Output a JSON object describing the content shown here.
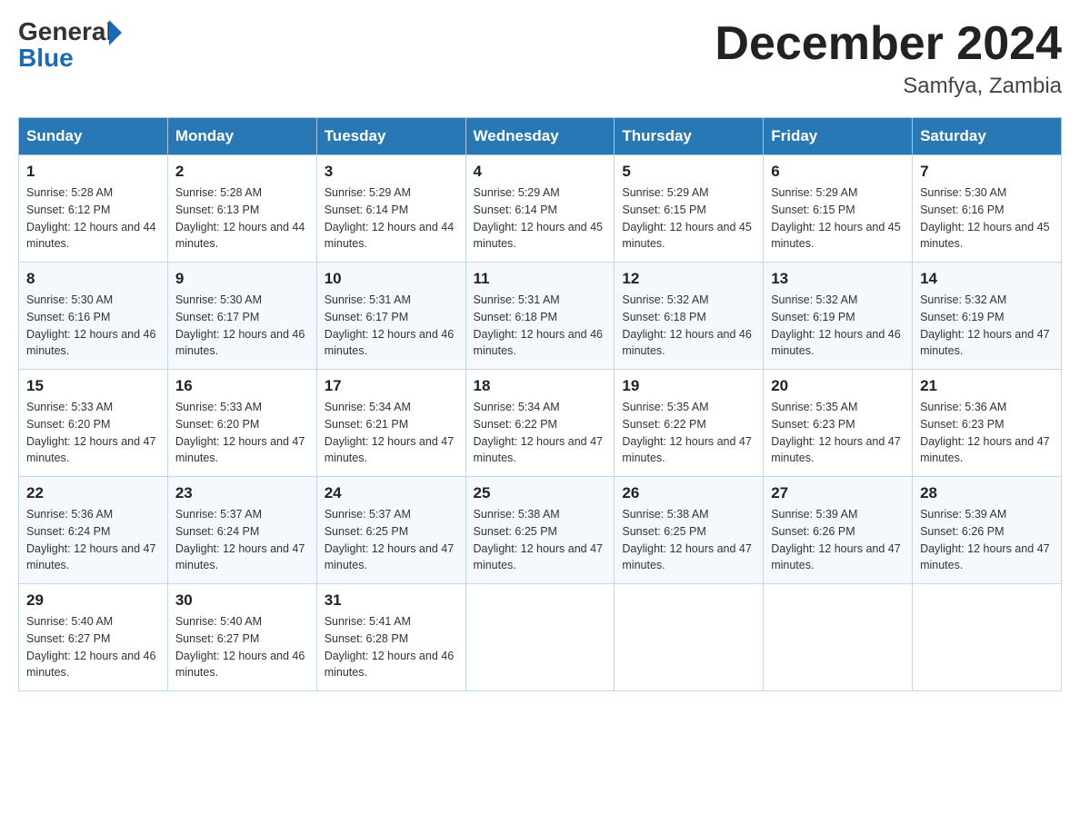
{
  "header": {
    "logo": {
      "general": "General",
      "blue": "Blue"
    },
    "title": "December 2024",
    "subtitle": "Samfya, Zambia"
  },
  "days_of_week": [
    "Sunday",
    "Monday",
    "Tuesday",
    "Wednesday",
    "Thursday",
    "Friday",
    "Saturday"
  ],
  "weeks": [
    [
      {
        "day": "1",
        "sunrise": "5:28 AM",
        "sunset": "6:12 PM",
        "daylight": "12 hours and 44 minutes."
      },
      {
        "day": "2",
        "sunrise": "5:28 AM",
        "sunset": "6:13 PM",
        "daylight": "12 hours and 44 minutes."
      },
      {
        "day": "3",
        "sunrise": "5:29 AM",
        "sunset": "6:14 PM",
        "daylight": "12 hours and 44 minutes."
      },
      {
        "day": "4",
        "sunrise": "5:29 AM",
        "sunset": "6:14 PM",
        "daylight": "12 hours and 45 minutes."
      },
      {
        "day": "5",
        "sunrise": "5:29 AM",
        "sunset": "6:15 PM",
        "daylight": "12 hours and 45 minutes."
      },
      {
        "day": "6",
        "sunrise": "5:29 AM",
        "sunset": "6:15 PM",
        "daylight": "12 hours and 45 minutes."
      },
      {
        "day": "7",
        "sunrise": "5:30 AM",
        "sunset": "6:16 PM",
        "daylight": "12 hours and 45 minutes."
      }
    ],
    [
      {
        "day": "8",
        "sunrise": "5:30 AM",
        "sunset": "6:16 PM",
        "daylight": "12 hours and 46 minutes."
      },
      {
        "day": "9",
        "sunrise": "5:30 AM",
        "sunset": "6:17 PM",
        "daylight": "12 hours and 46 minutes."
      },
      {
        "day": "10",
        "sunrise": "5:31 AM",
        "sunset": "6:17 PM",
        "daylight": "12 hours and 46 minutes."
      },
      {
        "day": "11",
        "sunrise": "5:31 AM",
        "sunset": "6:18 PM",
        "daylight": "12 hours and 46 minutes."
      },
      {
        "day": "12",
        "sunrise": "5:32 AM",
        "sunset": "6:18 PM",
        "daylight": "12 hours and 46 minutes."
      },
      {
        "day": "13",
        "sunrise": "5:32 AM",
        "sunset": "6:19 PM",
        "daylight": "12 hours and 46 minutes."
      },
      {
        "day": "14",
        "sunrise": "5:32 AM",
        "sunset": "6:19 PM",
        "daylight": "12 hours and 47 minutes."
      }
    ],
    [
      {
        "day": "15",
        "sunrise": "5:33 AM",
        "sunset": "6:20 PM",
        "daylight": "12 hours and 47 minutes."
      },
      {
        "day": "16",
        "sunrise": "5:33 AM",
        "sunset": "6:20 PM",
        "daylight": "12 hours and 47 minutes."
      },
      {
        "day": "17",
        "sunrise": "5:34 AM",
        "sunset": "6:21 PM",
        "daylight": "12 hours and 47 minutes."
      },
      {
        "day": "18",
        "sunrise": "5:34 AM",
        "sunset": "6:22 PM",
        "daylight": "12 hours and 47 minutes."
      },
      {
        "day": "19",
        "sunrise": "5:35 AM",
        "sunset": "6:22 PM",
        "daylight": "12 hours and 47 minutes."
      },
      {
        "day": "20",
        "sunrise": "5:35 AM",
        "sunset": "6:23 PM",
        "daylight": "12 hours and 47 minutes."
      },
      {
        "day": "21",
        "sunrise": "5:36 AM",
        "sunset": "6:23 PM",
        "daylight": "12 hours and 47 minutes."
      }
    ],
    [
      {
        "day": "22",
        "sunrise": "5:36 AM",
        "sunset": "6:24 PM",
        "daylight": "12 hours and 47 minutes."
      },
      {
        "day": "23",
        "sunrise": "5:37 AM",
        "sunset": "6:24 PM",
        "daylight": "12 hours and 47 minutes."
      },
      {
        "day": "24",
        "sunrise": "5:37 AM",
        "sunset": "6:25 PM",
        "daylight": "12 hours and 47 minutes."
      },
      {
        "day": "25",
        "sunrise": "5:38 AM",
        "sunset": "6:25 PM",
        "daylight": "12 hours and 47 minutes."
      },
      {
        "day": "26",
        "sunrise": "5:38 AM",
        "sunset": "6:25 PM",
        "daylight": "12 hours and 47 minutes."
      },
      {
        "day": "27",
        "sunrise": "5:39 AM",
        "sunset": "6:26 PM",
        "daylight": "12 hours and 47 minutes."
      },
      {
        "day": "28",
        "sunrise": "5:39 AM",
        "sunset": "6:26 PM",
        "daylight": "12 hours and 47 minutes."
      }
    ],
    [
      {
        "day": "29",
        "sunrise": "5:40 AM",
        "sunset": "6:27 PM",
        "daylight": "12 hours and 46 minutes."
      },
      {
        "day": "30",
        "sunrise": "5:40 AM",
        "sunset": "6:27 PM",
        "daylight": "12 hours and 46 minutes."
      },
      {
        "day": "31",
        "sunrise": "5:41 AM",
        "sunset": "6:28 PM",
        "daylight": "12 hours and 46 minutes."
      },
      null,
      null,
      null,
      null
    ]
  ]
}
